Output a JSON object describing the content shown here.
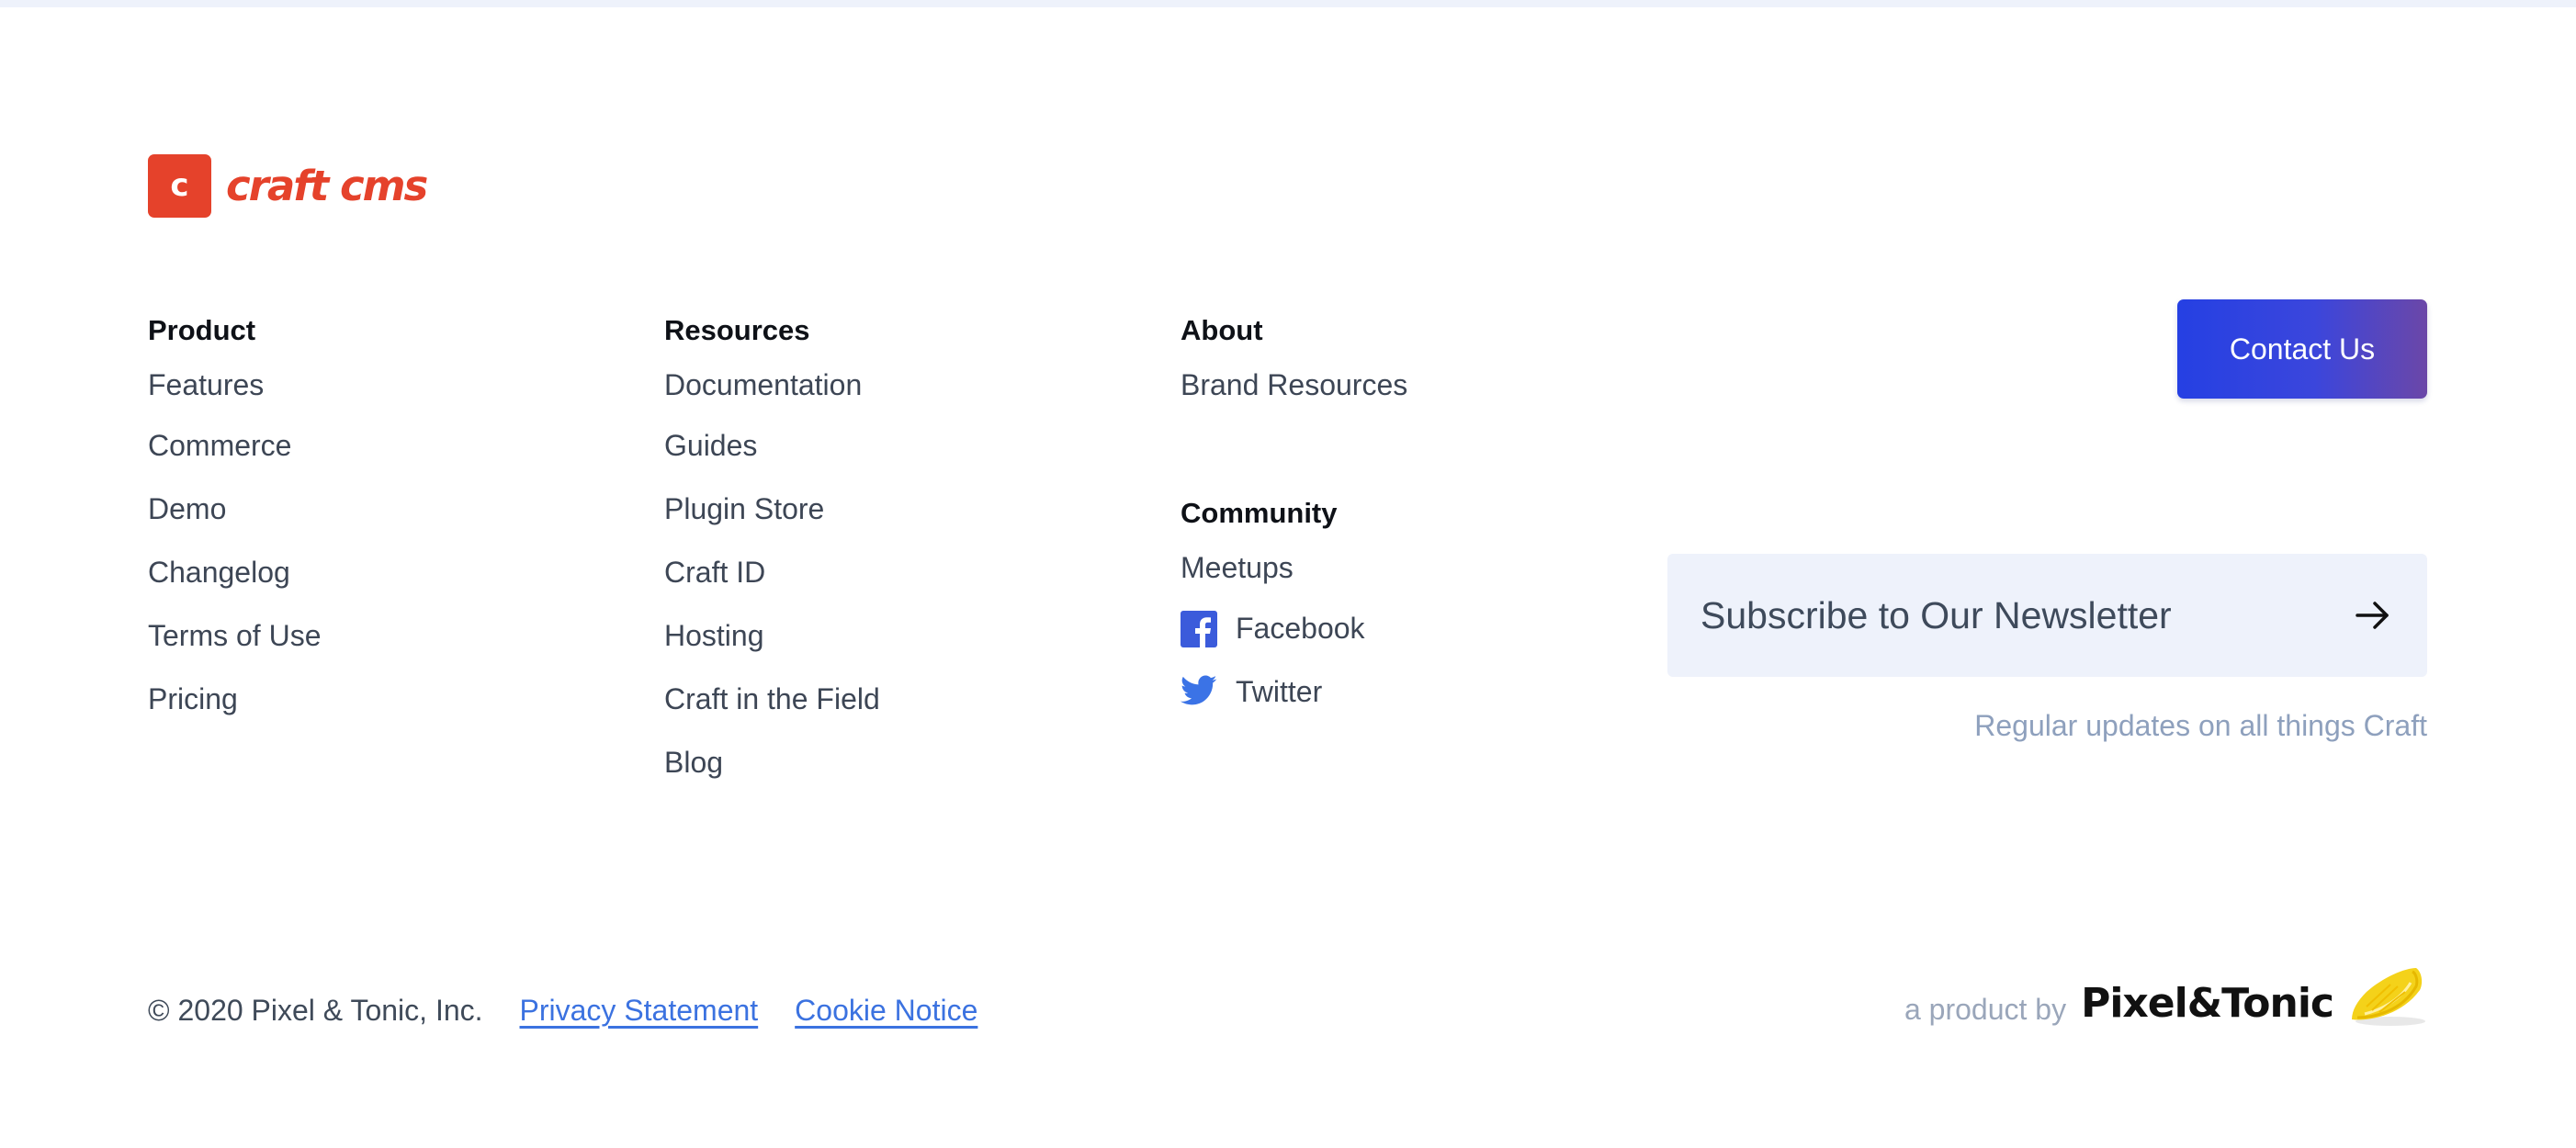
{
  "brand": {
    "logo_letter": "c",
    "logo_word": "craft cms",
    "accent": "#e5422b"
  },
  "columns": {
    "product": {
      "heading": "Product",
      "items": [
        "Features",
        "Commerce",
        "Demo",
        "Changelog",
        "Terms of Use",
        "Pricing"
      ]
    },
    "resources": {
      "heading": "Resources",
      "items": [
        "Documentation",
        "Guides",
        "Plugin Store",
        "Craft ID",
        "Hosting",
        "Craft in the Field",
        "Blog"
      ]
    },
    "about": {
      "heading": "About",
      "items": [
        "Brand Resources"
      ]
    },
    "community": {
      "heading": "Community",
      "items": [
        {
          "label": "Meetups",
          "icon": ""
        },
        {
          "label": "Facebook",
          "icon": "facebook-icon"
        },
        {
          "label": "Twitter",
          "icon": "twitter-icon"
        }
      ]
    }
  },
  "contact": {
    "button_label": "Contact Us",
    "gradient": [
      "#2540e3",
      "#6b47a8"
    ]
  },
  "newsletter": {
    "label": "Subscribe to Our Newsletter",
    "icon": "arrow-right-icon",
    "note": "Regular updates on all things Craft"
  },
  "footer": {
    "copyright": "© 2020 Pixel & Tonic, Inc.",
    "privacy_label": "Privacy Statement",
    "cookie_label": "Cookie Notice",
    "link_color": "#3b72e0",
    "byline": "a product by",
    "company_logo_text": "Pixel&Tonic",
    "company_logo_icon": "lemon-icon"
  }
}
